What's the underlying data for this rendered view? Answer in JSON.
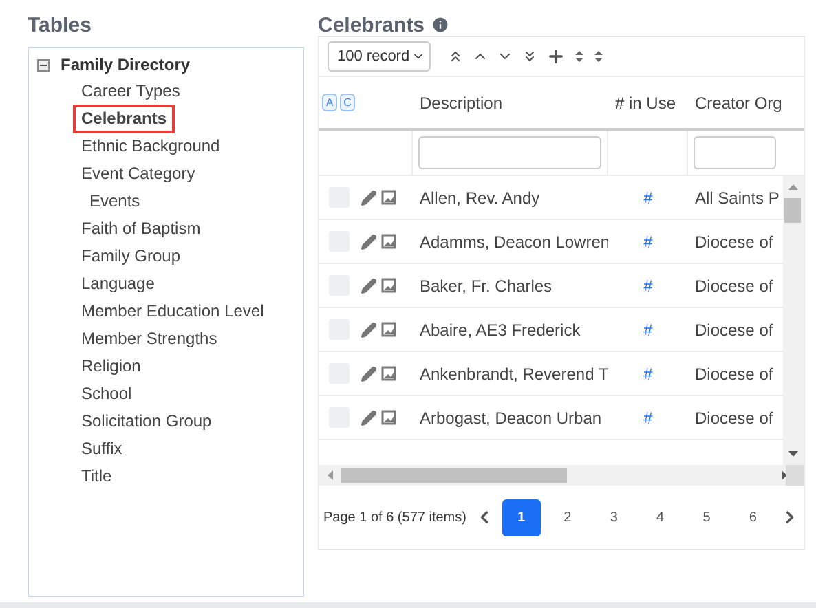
{
  "sidebar": {
    "title": "Tables",
    "tree": {
      "label": "Family Directory",
      "expanded": true,
      "children": [
        {
          "label": "Career Types",
          "selected": false
        },
        {
          "label": "Celebrants",
          "selected": true
        },
        {
          "label": "Ethnic Background",
          "selected": false
        },
        {
          "label": "Event Category",
          "selected": false,
          "children": [
            {
              "label": "Events",
              "selected": false
            }
          ]
        },
        {
          "label": "Faith of Baptism",
          "selected": false
        },
        {
          "label": "Family Group",
          "selected": false
        },
        {
          "label": "Language",
          "selected": false
        },
        {
          "label": "Member Education Level",
          "selected": false
        },
        {
          "label": "Member Strengths",
          "selected": false
        },
        {
          "label": "Religion",
          "selected": false
        },
        {
          "label": "School",
          "selected": false
        },
        {
          "label": "Solicitation Group",
          "selected": false
        },
        {
          "label": "Suffix",
          "selected": false
        },
        {
          "label": "Title",
          "selected": false
        }
      ]
    }
  },
  "main": {
    "title": "Celebrants",
    "page_size": "100 record",
    "header_toggles": [
      "A",
      "C"
    ],
    "columns": [
      "Description",
      "# in Use",
      "Creator Org"
    ],
    "rows": [
      {
        "checked": false,
        "description": "Allen, Rev. Andy",
        "in_use": "#",
        "creator_org": "All Saints P"
      },
      {
        "checked": false,
        "description": "Adamms, Deacon Lowren",
        "in_use": "#",
        "creator_org": "Diocese of"
      },
      {
        "checked": false,
        "description": "Baker, Fr. Charles",
        "in_use": "#",
        "creator_org": "Diocese of"
      },
      {
        "checked": false,
        "description": "Abaire, AE3 Frederick",
        "in_use": "#",
        "creator_org": "Diocese of"
      },
      {
        "checked": false,
        "description": "Ankenbrandt, Reverend T",
        "in_use": "#",
        "creator_org": "Diocese of"
      },
      {
        "checked": false,
        "description": "Arbogast, Deacon Urban",
        "in_use": "#",
        "creator_org": "Diocese of"
      }
    ],
    "pager": {
      "summary": "Page 1 of 6 (577 items)",
      "pages": [
        {
          "label": "1",
          "selected": true
        },
        {
          "label": "2",
          "selected": false
        },
        {
          "label": "3",
          "selected": false
        },
        {
          "label": "4",
          "selected": false
        },
        {
          "label": "5",
          "selected": false
        },
        {
          "label": "6",
          "selected": false
        }
      ]
    }
  }
}
